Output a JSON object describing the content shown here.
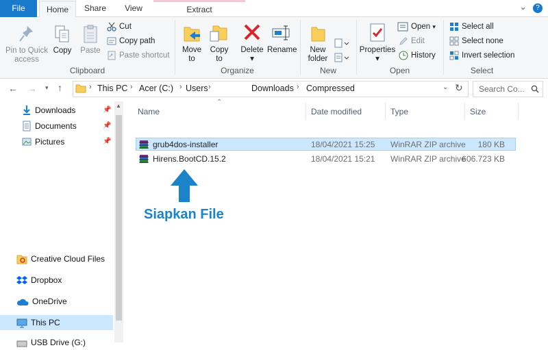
{
  "tabs": {
    "file": "File",
    "home": "Home",
    "share": "Share",
    "view": "View",
    "extract": "Extract"
  },
  "ribbon": {
    "clipboard": {
      "group": "Clipboard",
      "pin": "Pin to Quick access",
      "copy": "Copy",
      "paste": "Paste",
      "cut": "Cut",
      "copy_path": "Copy path",
      "paste_shortcut": "Paste shortcut"
    },
    "organize": {
      "group": "Organize",
      "move_to": "Move to",
      "copy_to": "Copy to",
      "delete": "Delete",
      "rename": "Rename"
    },
    "new": {
      "group": "New",
      "new_folder": "New folder"
    },
    "open": {
      "group": "Open",
      "properties": "Properties",
      "open": "Open",
      "edit": "Edit",
      "history": "History"
    },
    "select": {
      "group": "Select",
      "select_all": "Select all",
      "select_none": "Select none",
      "invert": "Invert selection"
    }
  },
  "address": {
    "crumbs": [
      "This PC",
      "Acer (C:)",
      "Users",
      "Downloads",
      "Compressed"
    ],
    "search_placeholder": "Search Co..."
  },
  "nav": {
    "quick": [
      "Downloads",
      "Documents",
      "Pictures"
    ],
    "other": [
      "Creative Cloud Files",
      "Dropbox",
      "OneDrive",
      "This PC",
      "USB Drive (G:)"
    ]
  },
  "columns": {
    "name": "Name",
    "date": "Date modified",
    "type": "Type",
    "size": "Size"
  },
  "files": [
    {
      "name": "grub4dos-installer",
      "date": "18/04/2021 15:25",
      "type": "WinRAR ZIP archive",
      "size": "180 KB",
      "selected": true
    },
    {
      "name": "Hirens.BootCD.15.2",
      "date": "18/04/2021 15:21",
      "type": "WinRAR ZIP archive",
      "size": "606.723 KB",
      "selected": false
    }
  ],
  "annotation": {
    "text": "Siapkan File",
    "color": "#1a83c9"
  },
  "colors": {
    "accent": "#1979ca",
    "selection": "#cce8ff"
  }
}
